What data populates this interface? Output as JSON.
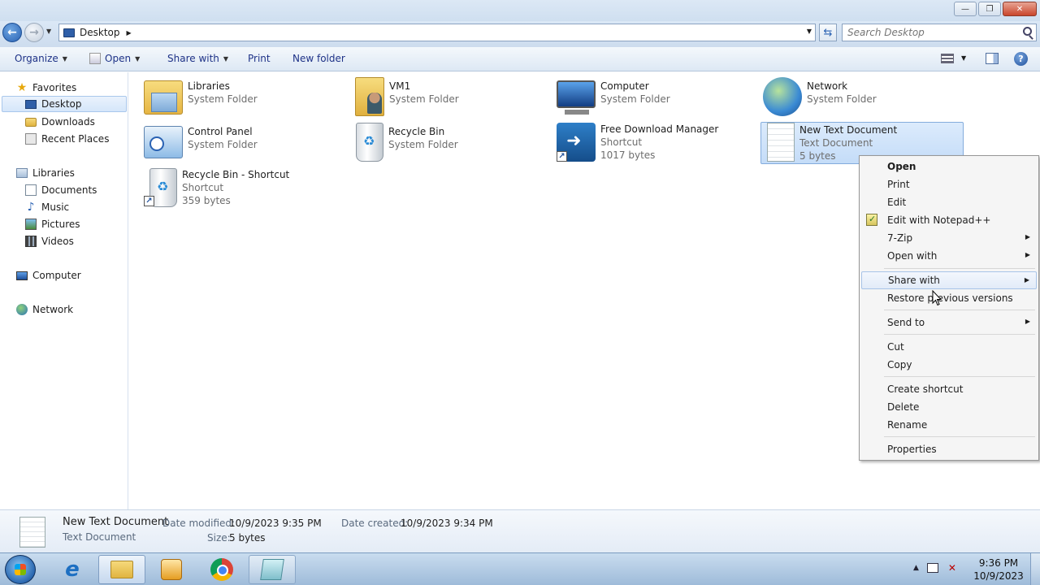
{
  "window": {
    "minimize": "—",
    "maximize": "❐",
    "close": "✕"
  },
  "address": {
    "location": "Desktop",
    "search_placeholder": "Search Desktop"
  },
  "toolbar": {
    "organize": "Organize",
    "open": "Open",
    "share_with": "Share with",
    "print": "Print",
    "new_folder": "New folder"
  },
  "navpane": {
    "favorites": "Favorites",
    "desktop": "Desktop",
    "downloads": "Downloads",
    "recent_places": "Recent Places",
    "libraries": "Libraries",
    "documents": "Documents",
    "music": "Music",
    "pictures": "Pictures",
    "videos": "Videos",
    "computer": "Computer",
    "network": "Network"
  },
  "items": [
    {
      "name": "Libraries",
      "sub1": "System Folder",
      "sub2": ""
    },
    {
      "name": "VM1",
      "sub1": "System Folder",
      "sub2": ""
    },
    {
      "name": "Computer",
      "sub1": "System Folder",
      "sub2": ""
    },
    {
      "name": "Network",
      "sub1": "System Folder",
      "sub2": ""
    },
    {
      "name": "Control Panel",
      "sub1": "System Folder",
      "sub2": ""
    },
    {
      "name": "Recycle Bin",
      "sub1": "System Folder",
      "sub2": ""
    },
    {
      "name": "Free Download Manager",
      "sub1": "Shortcut",
      "sub2": "1017 bytes"
    },
    {
      "name": "New Text Document",
      "sub1": "Text Document",
      "sub2": "5 bytes"
    },
    {
      "name": "Recycle Bin - Shortcut",
      "sub1": "Shortcut",
      "sub2": "359 bytes"
    }
  ],
  "context_menu": {
    "open": "Open",
    "print": "Print",
    "edit": "Edit",
    "edit_notepadpp": "Edit with Notepad++",
    "sevenzip": "7-Zip",
    "open_with": "Open with",
    "share_with": "Share with",
    "restore": "Restore previous versions",
    "send_to": "Send to",
    "cut": "Cut",
    "copy": "Copy",
    "create_shortcut": "Create shortcut",
    "delete": "Delete",
    "rename": "Rename",
    "properties": "Properties"
  },
  "details": {
    "name": "New Text Document",
    "type": "Text Document",
    "date_modified_label": "Date modified:",
    "date_modified": "10/9/2023 9:35 PM",
    "size_label": "Size:",
    "size": "5 bytes",
    "date_created_label": "Date created:",
    "date_created": "10/9/2023 9:34 PM"
  },
  "taskbar": {
    "time": "9:36 PM",
    "date": "10/9/2023"
  },
  "colors": {
    "selection": "#c4dcf8",
    "command_text": "#1e3287",
    "secondary_text": "#6d6d6d"
  }
}
